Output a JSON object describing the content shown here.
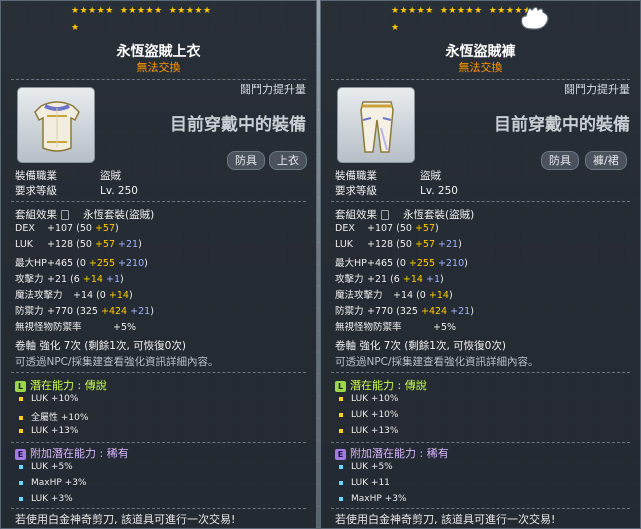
{
  "tooltips": [
    {
      "title": "永恆盜賊上衣",
      "trade": "無法交換",
      "stars_top": "★★★★★ ★★★★★ ★★★★★",
      "star_extra": "★",
      "power_label": "鬪鬥力提升量",
      "equipped_text": "目前穿戴中的裝備",
      "tags": [
        "防具",
        "上衣"
      ],
      "job_label": "裝備職業",
      "job_value": "盜賊",
      "level_label": "要求等級",
      "level_value": "Lv. 250",
      "set_label": "套組效果",
      "set_value": "永恆套裝(盜賊)",
      "stats": [
        {
          "name": "DEX",
          "total": "+107",
          "base": "(50",
          "a": "+57",
          "b": "",
          "close": ")"
        },
        {
          "name": "LUK",
          "total": "+128",
          "base": "(50",
          "a": "+57",
          "b": "+21",
          "close": ")"
        },
        {
          "name": "最大HP",
          "total": "+465",
          "base": "(0",
          "a": "+255",
          "b": "+210",
          "close": ")"
        },
        {
          "name": "攻擊力",
          "total": "+21",
          "base": "(6",
          "a": "+14",
          "b": "+1",
          "close": ")"
        },
        {
          "name": "魔法攻擊力",
          "total": "+14",
          "base": "(0",
          "a": "+14",
          "b": "",
          "close": ")"
        },
        {
          "name": "防禦力",
          "total": "+770",
          "base": "(325",
          "a": "+424",
          "b": "+21",
          "close": ")"
        },
        {
          "name": "無視怪物防禦率",
          "total": "+5%",
          "base": "",
          "a": "",
          "b": "",
          "close": ""
        }
      ],
      "scroll_line": "卷軸 強化 7次 (剩餘1次, 可恢復0次)",
      "npc_line": "可透過NPC/採集建查看強化資訊詳細內容。",
      "potential_label": "潛在能力 : ",
      "potential_grade": "傳說",
      "potential_lines": [
        "LUK +10%",
        "全屬性 +10%",
        "LUK +13%"
      ],
      "additional_label": "附加潛在能力 : ",
      "additional_grade": "稀有",
      "additional_lines": [
        "LUK +5%",
        "MaxHP +3%",
        "LUK +3%"
      ],
      "footer": "若使用白金神奇剪刀, 該道具可進行一次交易!"
    },
    {
      "title": "永恆盜賊褲",
      "trade": "無法交換",
      "stars_top": "★★★★★ ★★★★★ ★★★★★",
      "star_extra": "★",
      "power_label": "鬪鬥力提升量",
      "equipped_text": "目前穿戴中的裝備",
      "tags": [
        "防具",
        "褲/裙"
      ],
      "job_label": "裝備職業",
      "job_value": "盜賊",
      "level_label": "要求等級",
      "level_value": "Lv. 250",
      "set_label": "套組效果",
      "set_value": "永恆套裝(盜賊)",
      "stats": [
        {
          "name": "DEX",
          "total": "+107",
          "base": "(50",
          "a": "+57",
          "b": "",
          "close": ")"
        },
        {
          "name": "LUK",
          "total": "+128",
          "base": "(50",
          "a": "+57",
          "b": "+21",
          "close": ")"
        },
        {
          "name": "最大HP",
          "total": "+465",
          "base": "(0",
          "a": "+255",
          "b": "+210",
          "close": ")"
        },
        {
          "name": "攻擊力",
          "total": "+21",
          "base": "(6",
          "a": "+14",
          "b": "+1",
          "close": ")"
        },
        {
          "name": "魔法攻擊力",
          "total": "+14",
          "base": "(0",
          "a": "+14",
          "b": "",
          "close": ")"
        },
        {
          "name": "防禦力",
          "total": "+770",
          "base": "(325",
          "a": "+424",
          "b": "+21",
          "close": ")"
        },
        {
          "name": "無視怪物防禦率",
          "total": "+5%",
          "base": "",
          "a": "",
          "b": "",
          "close": ""
        }
      ],
      "scroll_line": "卷軸 強化 7次 (剩餘1次, 可恢復0次)",
      "npc_line": "可透過NPC/採集建查看強化資訊詳細內容。",
      "potential_label": "潛在能力 : ",
      "potential_grade": "傳說",
      "potential_lines": [
        "LUK +10%",
        "LUK +10%",
        "LUK +13%"
      ],
      "additional_label": "附加潛在能力 : ",
      "additional_grade": "稀有",
      "additional_lines": [
        "LUK +5%",
        "LUK +11",
        "MaxHP +3%"
      ],
      "footer": "若使用白金神奇剪刀, 該道具可進行一次交易!"
    }
  ],
  "colors": {
    "gold": "#ffcc00",
    "blue": "#9fb4ff",
    "trade": "#ff9900",
    "legend": "#c8ff4a",
    "rare": "#d8b6ff"
  },
  "icons": [
    "shirt-item-icon",
    "pants-item-icon",
    "lock-icon",
    "white-glove-cursor-icon"
  ]
}
